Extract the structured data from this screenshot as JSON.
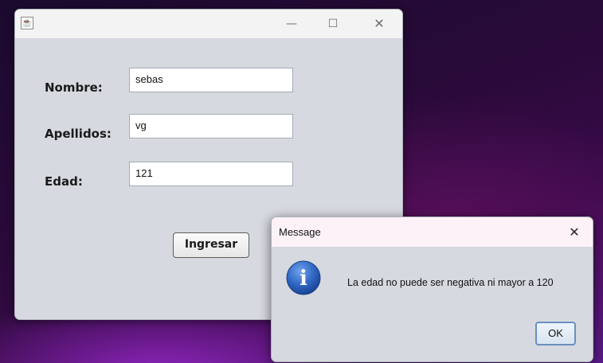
{
  "main_window": {
    "title": "",
    "controls": {
      "minimize": "—",
      "maximize": "☐",
      "close": "✕"
    },
    "form": {
      "nombre_label": "Nombre:",
      "nombre_value": "sebas",
      "apellidos_label": "Apellidos:",
      "apellidos_value": "vg",
      "edad_label": "Edad:",
      "edad_value": "121"
    },
    "submit_label": "Ingresar"
  },
  "dialog": {
    "title": "Message",
    "close": "✕",
    "icon": "info-icon",
    "icon_glyph": "i",
    "message": "La edad no puede ser negativa ni mayor a 120",
    "ok_label": "OK"
  }
}
